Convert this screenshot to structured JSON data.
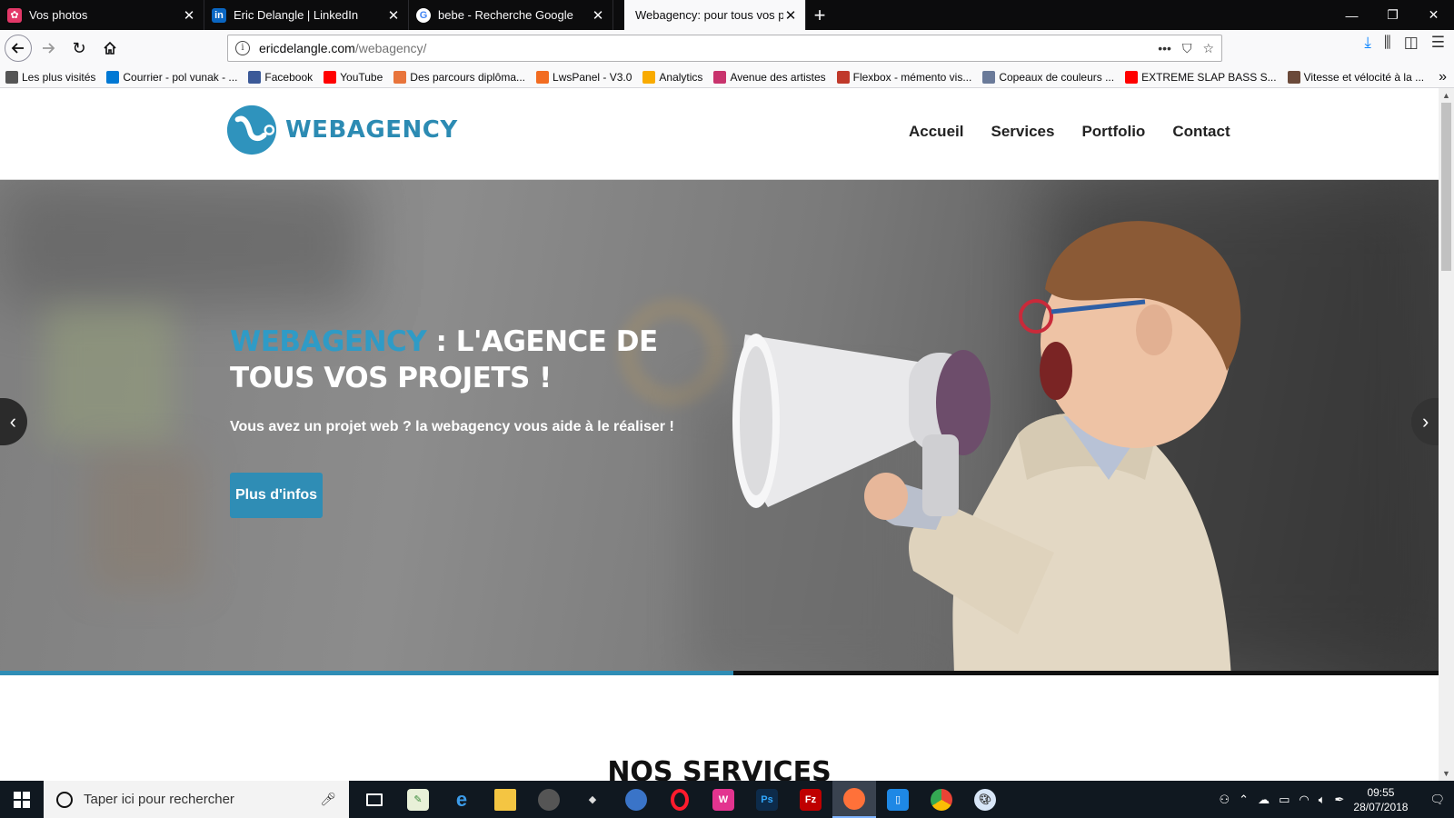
{
  "browser": {
    "tabs": [
      {
        "title": "Vos photos",
        "favicon": "photos-icon",
        "color": "#e33868"
      },
      {
        "title": "Eric Delangle | LinkedIn",
        "favicon": "linkedin-icon",
        "color": "#0a66c2"
      },
      {
        "title": "bebe - Recherche Google",
        "favicon": "google-icon",
        "color": "#4285f4"
      },
      {
        "title": "Webagency: pour tous vos proj",
        "favicon": "none",
        "active": true
      }
    ],
    "url_domain": "ericdelangle.com",
    "url_path": "/webagency/"
  },
  "bookmarks": [
    {
      "label": "Les plus visités",
      "icon": "gear-icon",
      "color": "#555"
    },
    {
      "label": "Courrier - pol vunak - ...",
      "icon": "outlook-icon",
      "color": "#0078d4"
    },
    {
      "label": "Facebook",
      "icon": "facebook-icon",
      "color": "#3b5998"
    },
    {
      "label": "YouTube",
      "icon": "youtube-icon",
      "color": "#ff0000"
    },
    {
      "label": "Des parcours diplôma...",
      "icon": "openclassrooms-icon",
      "color": "#e8743b"
    },
    {
      "label": "LwsPanel - V3.0",
      "icon": "lws-icon",
      "color": "#f26c21"
    },
    {
      "label": "Analytics",
      "icon": "analytics-icon",
      "color": "#f9ab00"
    },
    {
      "label": "Avenue des artistes",
      "icon": "avenue-icon",
      "color": "#c8336d"
    },
    {
      "label": "Flexbox - mémento vis...",
      "icon": "flexbox-icon",
      "color": "#c0392b"
    },
    {
      "label": "Copeaux de couleurs ...",
      "icon": "copeaux-icon",
      "color": "#6a7a99"
    },
    {
      "label": "EXTREME SLAP BASS S...",
      "icon": "youtube-icon",
      "color": "#ff0000"
    },
    {
      "label": "Vitesse et vélocité à la ...",
      "icon": "image-icon",
      "color": "#6b4a3a"
    }
  ],
  "site": {
    "logo_text": "WEBAGENCY",
    "menu": [
      "Accueil",
      "Services",
      "Portfolio",
      "Contact"
    ],
    "hero": {
      "title_brand": "WEBAGENCY",
      "title_rest": " : L'AGENCE DE TOUS VOS PROJETS !",
      "subtitle": "Vous avez un projet web ? la webagency vous aide à le réaliser !",
      "button": "Plus d'infos",
      "slider_progress": 0.51
    },
    "next_section_title": "NOS SERVICES"
  },
  "taskbar": {
    "search_placeholder": "Taper ici pour rechercher",
    "time": "09:55",
    "date": "28/07/2018"
  },
  "colors": {
    "brand": "#2f8db5",
    "hero_title_brand": "#2f9bc6"
  }
}
